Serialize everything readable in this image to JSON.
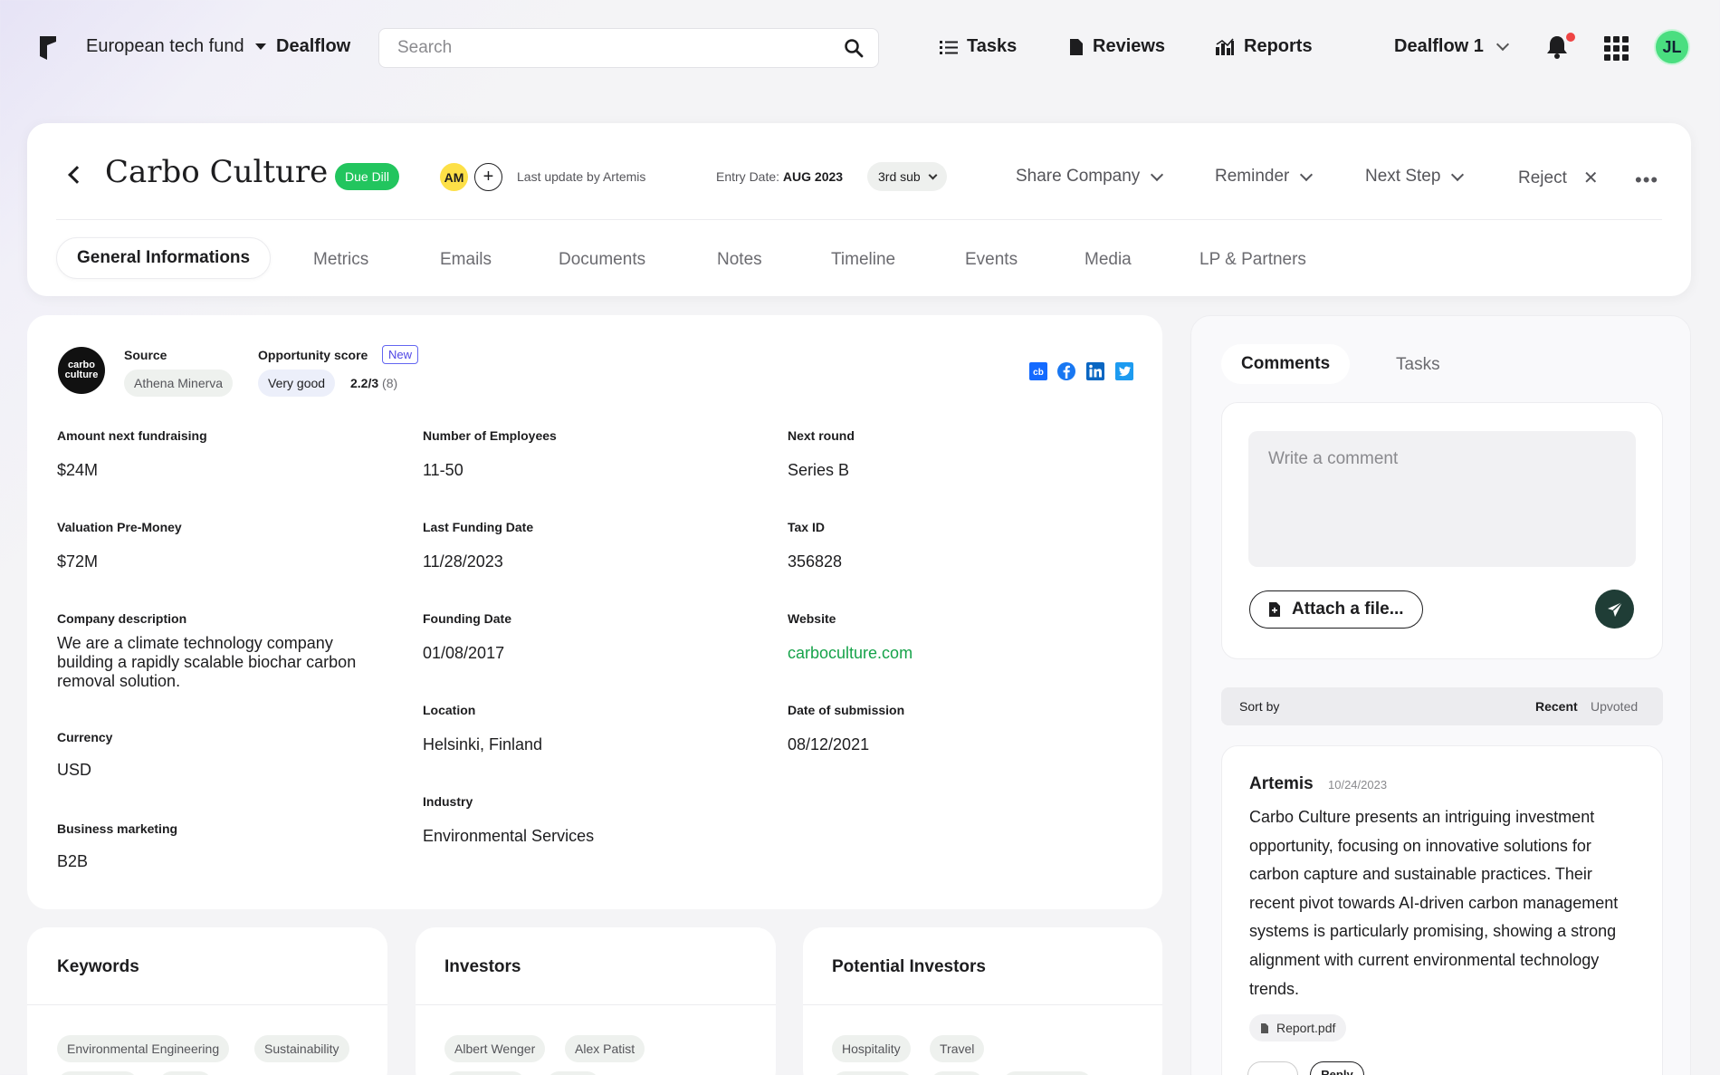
{
  "topnav": {
    "fund_name": "European tech fund",
    "dealflow_link": "Dealflow",
    "search_placeholder": "Search",
    "tasks": "Tasks",
    "reviews": "Reviews",
    "reports": "Reports",
    "dealflow_selector": "Dealflow 1",
    "avatar_initials": "JL",
    "notification_dot_color": "#ef4444"
  },
  "company": {
    "name": "Carbo Culture",
    "stage": "Due Dill",
    "owner_initials": "AM",
    "add_owner": "+",
    "last_update": "Last update by Artemis",
    "entry_date_label": "Entry Date:",
    "entry_date_value": "AUG 2023",
    "submission": "3rd sub",
    "stage_color": "#22c55e"
  },
  "actions": {
    "share": "Share Company",
    "reminder": "Reminder",
    "next_step": "Next Step",
    "reject": "Reject",
    "more": "•••"
  },
  "tabs": [
    "General Informations",
    "Metrics",
    "Emails",
    "Documents",
    "Notes",
    "Timeline",
    "Events",
    "Media",
    "LP & Partners"
  ],
  "info": {
    "logo_text": "carbo culture",
    "source_label": "Source",
    "source_value": "Athena Minerva",
    "score_label": "Opportunity  score",
    "score_badge": "New",
    "score_rating": "Very good",
    "score_value": "2.2/3",
    "score_count": "(8)",
    "fields": {
      "amount_label": "Amount next fundraising",
      "amount_value": "$24M",
      "employees_label": "Number of Employees",
      "employees_value": "11-50",
      "next_round_label": "Next round",
      "next_round_value": "Series B",
      "valuation_label": "Valuation Pre-Money",
      "valuation_value": "$72M",
      "last_funding_label": "Last Funding Date",
      "last_funding_value": "11/28/2023",
      "tax_label": "Tax ID",
      "tax_value": "356828",
      "description_label": "Company description",
      "description_value": "We are a climate technology company building a rapidly scalable biochar carbon removal solution.",
      "founding_label": "Founding Date",
      "founding_value": "01/08/2017",
      "website_label": "Website",
      "website_value": "carboculture.com",
      "location_label": "Location",
      "location_value": "Helsinki, Finland",
      "submission_label": "Date of submission",
      "submission_value": "08/12/2021",
      "currency_label": "Currency",
      "currency_value": "USD",
      "industry_label": "Industry",
      "industry_value": "Environmental Services",
      "marketing_label": "Business marketing",
      "marketing_value": "B2B"
    }
  },
  "keywords": {
    "title": "Keywords",
    "items": [
      "Environmental Engineering",
      "Sustainability"
    ]
  },
  "investors": {
    "title": "Investors",
    "items": [
      "Albert Wenger",
      "Alex Patist"
    ]
  },
  "potential_investors": {
    "title": "Potential Investors",
    "items": [
      "Hospitality",
      "Travel"
    ]
  },
  "comments_panel": {
    "tab_comments": "Comments",
    "tab_tasks": "Tasks",
    "comment_placeholder": "Write a comment",
    "attach_label": "Attach a file...",
    "sort_by": "Sort by",
    "sort_recent": "Recent",
    "sort_upvoted": "Upvoted",
    "comment": {
      "author": "Artemis",
      "date": "10/24/2023",
      "text": "Carbo Culture presents an intriguing investment opportunity, focusing on innovative solutions for carbon capture and sustainable practices. Their recent pivot towards AI-driven carbon management systems is particularly promising, showing a strong alignment with current environmental technology trends.",
      "attachment": "Report.pdf",
      "reply_label": "Reply"
    }
  }
}
